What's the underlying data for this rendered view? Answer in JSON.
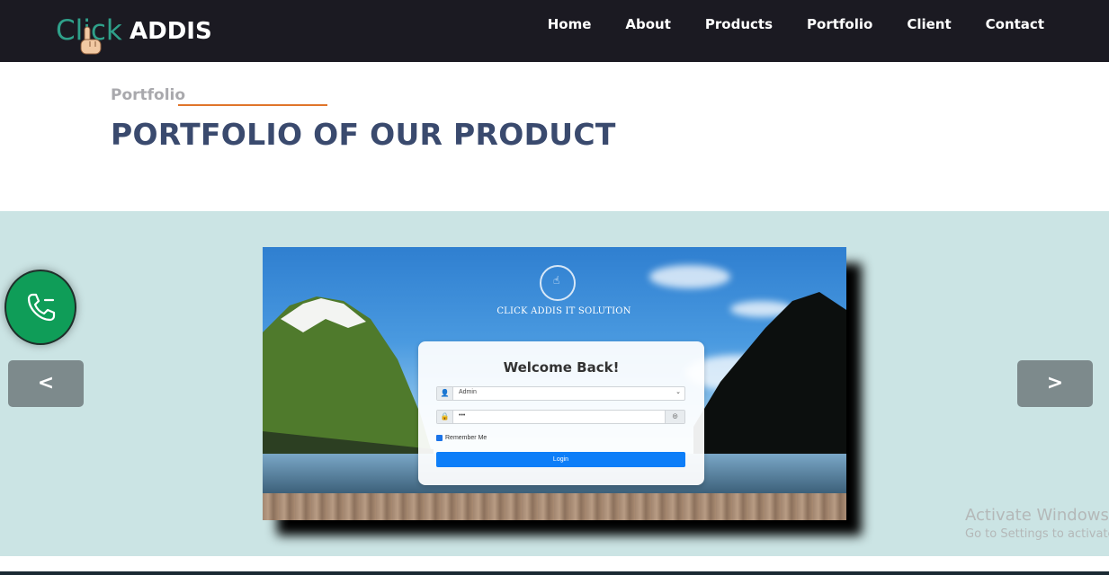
{
  "header": {
    "logo_click": "Click",
    "logo_addis": "ADDIS",
    "nav": [
      "Home",
      "About",
      "Products",
      "Portfolio",
      "Client",
      "Contact"
    ]
  },
  "section": {
    "kicker": "Portfolio",
    "title": "PORTFOLIO OF OUR PRODUCT"
  },
  "slide": {
    "brand_text": "CLICK ADDIS IT SOLUTION",
    "login_title": "Welcome Back!",
    "role_value": "Admin",
    "password_value": "•••",
    "remember_label": "Remember Me",
    "login_button": "Login"
  },
  "carousel": {
    "prev_label": "<",
    "next_label": ">"
  },
  "watermark": {
    "title": "Activate Windows",
    "subtitle": "Go to Settings to activate"
  },
  "icons": [
    "hand-pointer-icon",
    "phone-icon",
    "user-icon",
    "lock-icon",
    "eye-slash-icon",
    "chevron-down-icon"
  ],
  "colors": {
    "navbar": "#1b1a22",
    "logo_accent": "#2fa08a",
    "title": "#3a4a6e",
    "kicker_line": "#e0752a",
    "carousel_bg": "#cbe4e4",
    "phone": "#0f9d58",
    "login_button": "#0d7ef8"
  }
}
